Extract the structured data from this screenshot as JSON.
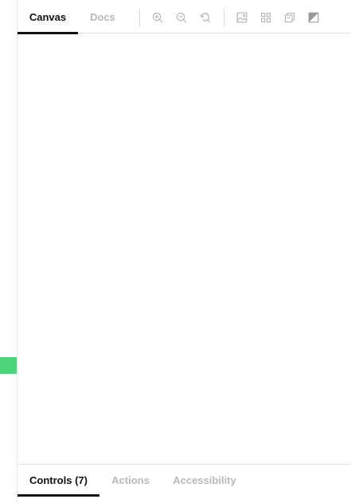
{
  "sidebar_handle": {
    "color": "#4cd37b"
  },
  "toolbar": {
    "tabs": [
      {
        "label": "Canvas",
        "active": true
      },
      {
        "label": "Docs",
        "active": false
      }
    ],
    "tools": [
      {
        "icon": "zoom-in-icon"
      },
      {
        "icon": "zoom-out-icon"
      },
      {
        "icon": "reset-zoom-icon"
      },
      {
        "icon": "background-image-icon"
      },
      {
        "icon": "grid-icon"
      },
      {
        "icon": "outline-icon"
      },
      {
        "icon": "contrast-icon"
      }
    ]
  },
  "addons": {
    "tabs": [
      {
        "label": "Controls (7)",
        "active": true
      },
      {
        "label": "Actions",
        "active": false
      },
      {
        "label": "Accessibility",
        "active": false
      }
    ]
  },
  "colors": {
    "active_text": "#111111",
    "inactive_text": "#b9b9b9",
    "border": "#e3e3e3",
    "icon": "#b3b3b3"
  }
}
